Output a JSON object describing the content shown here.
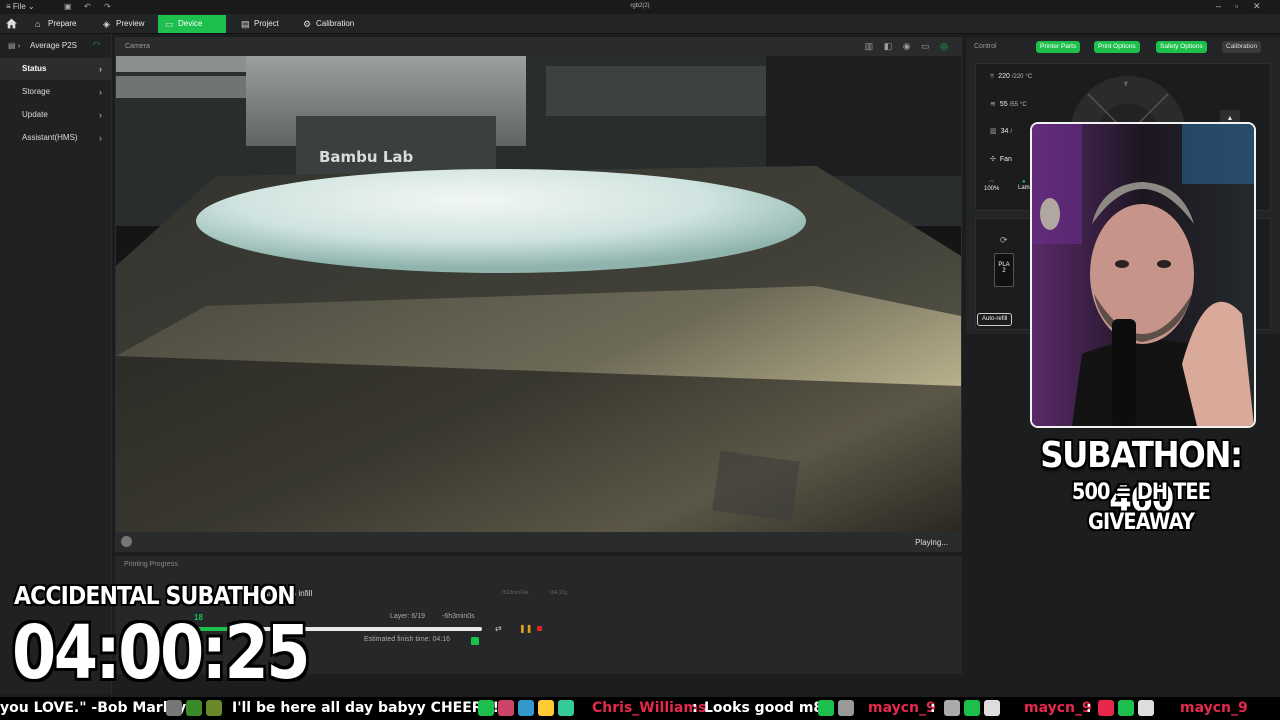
{
  "titlebar": {
    "file_label": "File",
    "window_title": "rgb2(2)"
  },
  "tabs": [
    {
      "label": "Prepare",
      "icon": "cube-icon"
    },
    {
      "label": "Preview",
      "icon": "preview-icon"
    },
    {
      "label": "Device",
      "icon": "device-icon",
      "active": true
    },
    {
      "label": "Project",
      "icon": "project-icon"
    },
    {
      "label": "Calibration",
      "icon": "calibration-icon"
    }
  ],
  "sidebar": {
    "device_name": "Average P2S",
    "items": [
      {
        "label": "Status",
        "active": true
      },
      {
        "label": "Storage"
      },
      {
        "label": "Update"
      },
      {
        "label": "Assistant(HMS)"
      }
    ]
  },
  "camera": {
    "header": "Camera",
    "status": "Playing...",
    "printhead_brand": "Bambu Lab"
  },
  "progress": {
    "header": "Printing Progress",
    "description": "walls, 15% infill",
    "meta_left": "7h23min24s",
    "meta_right": "164.17g",
    "percent_label": "18",
    "percent_value": 0.18,
    "layer": "Layer: 6/19",
    "remaining": "-6h3min0s",
    "finish": "Estimated finish time: 04:16"
  },
  "control": {
    "header": "Control",
    "chips": [
      "Printer Parts",
      "Print Options",
      "Safety Options",
      "Calibration"
    ],
    "nozzle_temp": "220",
    "nozzle_target": "/220",
    "bed_temp": "55",
    "bed_target": "/55",
    "chamber_temp": "34",
    "chamber_target": "/",
    "unit": "°C",
    "fan_label": "Fan",
    "speed_label": "100%",
    "lamp_label": "Lam",
    "filament_label": "PLA",
    "filament_slot": "2",
    "autorefill_label": "Auto-refill",
    "axis_label": "Y"
  },
  "overlay": {
    "subathon": "SUBATHON: 460",
    "goal": "500 = DH TEE GIVEAWAY",
    "accidental": "ACCIDENTAL SUBATHON",
    "timer": "04:00:25"
  },
  "ticker": {
    "quote": "you LOVE.\" -Bob Marley",
    "msg1": "I'll be here all day babyy CHEERS!!",
    "user1": "Chris_Williams",
    "msg2": "Looks good m8",
    "user2": "maycn_9",
    "user3": "maycn_9",
    "user4": "maycn_9",
    "colon": ":"
  },
  "colors": {
    "accent": "#1ec04d",
    "panel": "#232425",
    "danger": "#e02222",
    "chat_user": "#e6284a"
  }
}
